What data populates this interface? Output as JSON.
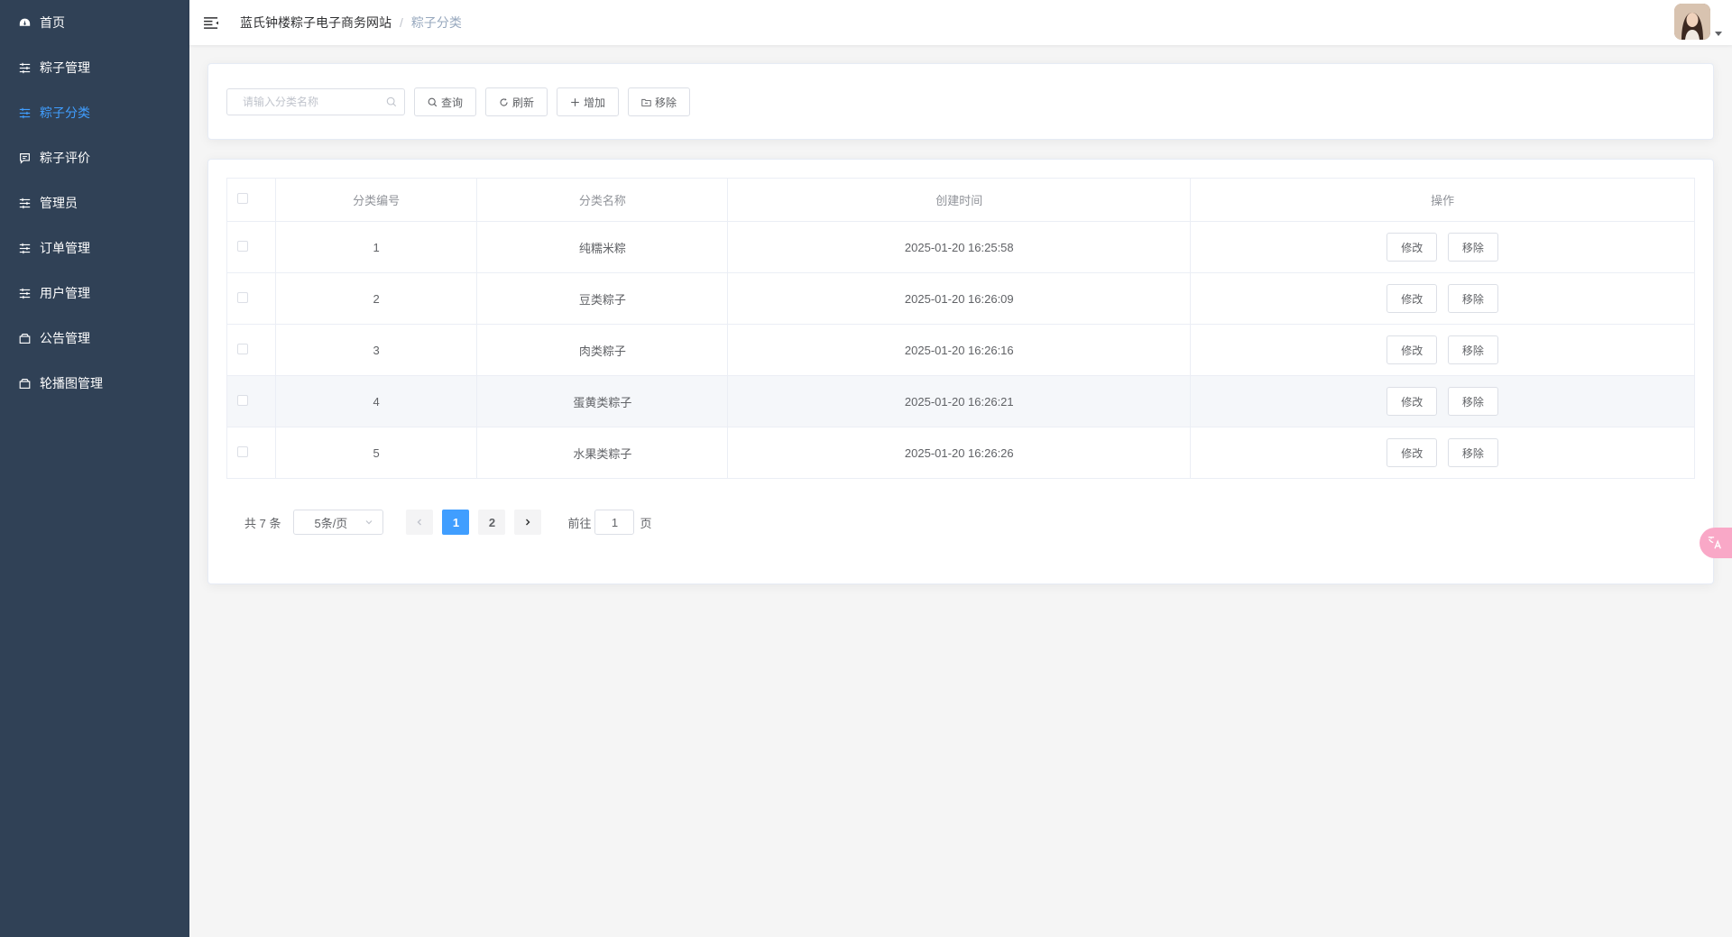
{
  "sidebar": {
    "items": [
      {
        "label": "首页",
        "icon": "dashboard-icon",
        "active": false
      },
      {
        "label": "粽子管理",
        "icon": "sliders-icon",
        "active": false
      },
      {
        "label": "粽子分类",
        "icon": "sliders-icon",
        "active": true
      },
      {
        "label": "粽子评价",
        "icon": "comment-icon",
        "active": false
      },
      {
        "label": "管理员",
        "icon": "sliders-icon",
        "active": false
      },
      {
        "label": "订单管理",
        "icon": "sliders-icon",
        "active": false
      },
      {
        "label": "用户管理",
        "icon": "sliders-icon",
        "active": false
      },
      {
        "label": "公告管理",
        "icon": "box-icon",
        "active": false
      },
      {
        "label": "轮播图管理",
        "icon": "box-icon",
        "active": false
      }
    ]
  },
  "header": {
    "breadcrumb_home": "蓝氏钟楼粽子电子商务网站",
    "breadcrumb_sep": "/",
    "breadcrumb_current": "粽子分类"
  },
  "toolbar": {
    "search_placeholder": "请输入分类名称",
    "search_label": "查询",
    "refresh_label": "刷新",
    "add_label": "增加",
    "remove_label": "移除"
  },
  "table": {
    "columns": [
      "分类编号",
      "分类名称",
      "创建时间",
      "操作"
    ],
    "rows": [
      {
        "id": "1",
        "name": "纯糯米粽",
        "created": "2025-01-20 16:25:58"
      },
      {
        "id": "2",
        "name": "豆类粽子",
        "created": "2025-01-20 16:26:09"
      },
      {
        "id": "3",
        "name": "肉类粽子",
        "created": "2025-01-20 16:26:16"
      },
      {
        "id": "4",
        "name": "蛋黄类粽子",
        "created": "2025-01-20 16:26:21"
      },
      {
        "id": "5",
        "name": "水果类粽子",
        "created": "2025-01-20 16:26:26"
      }
    ],
    "edit_label": "修改",
    "delete_label": "移除"
  },
  "pagination": {
    "total_text": "共 7 条",
    "page_size": "5条/页",
    "pages": [
      "1",
      "2"
    ],
    "current_page": "1",
    "goto_prefix": "前往",
    "goto_value": "1",
    "goto_suffix": "页"
  },
  "colors": {
    "sidebar_bg": "#304156",
    "accent": "#409EFF",
    "float_button": "#f9a8c7"
  }
}
